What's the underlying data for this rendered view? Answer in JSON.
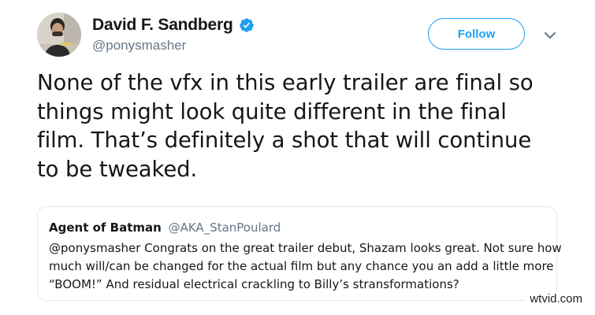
{
  "tweet": {
    "author_name": "David F. Sandberg",
    "author_handle": "@ponysmasher",
    "follow_label": "Follow",
    "text_lines": [
      "None of the vfx in this early trailer are final so",
      "things might look quite different in the final",
      "film. That’s definitely a shot that will continue",
      "to be tweaked."
    ]
  },
  "quoted_tweet": {
    "author_name": "Agent of Batman",
    "author_handle": "@AKA_StanPoulard",
    "text_lines": [
      "@ponysmasher Congrats on the great trailer debut, Shazam looks great. Not sure how",
      "much will/can be changed for the actual film but any chance you an add a little more",
      "“BOOM!” And residual electrical crackling to Billy’s stransformations?"
    ]
  },
  "watermark": "wtvid.com",
  "colors": {
    "accent": "#1da1f2",
    "text": "#14171a",
    "secondary_text": "#657786",
    "border": "#e1e8ed"
  },
  "icons": {
    "verified": "verified-badge-icon",
    "menu": "chevron-down-icon"
  }
}
